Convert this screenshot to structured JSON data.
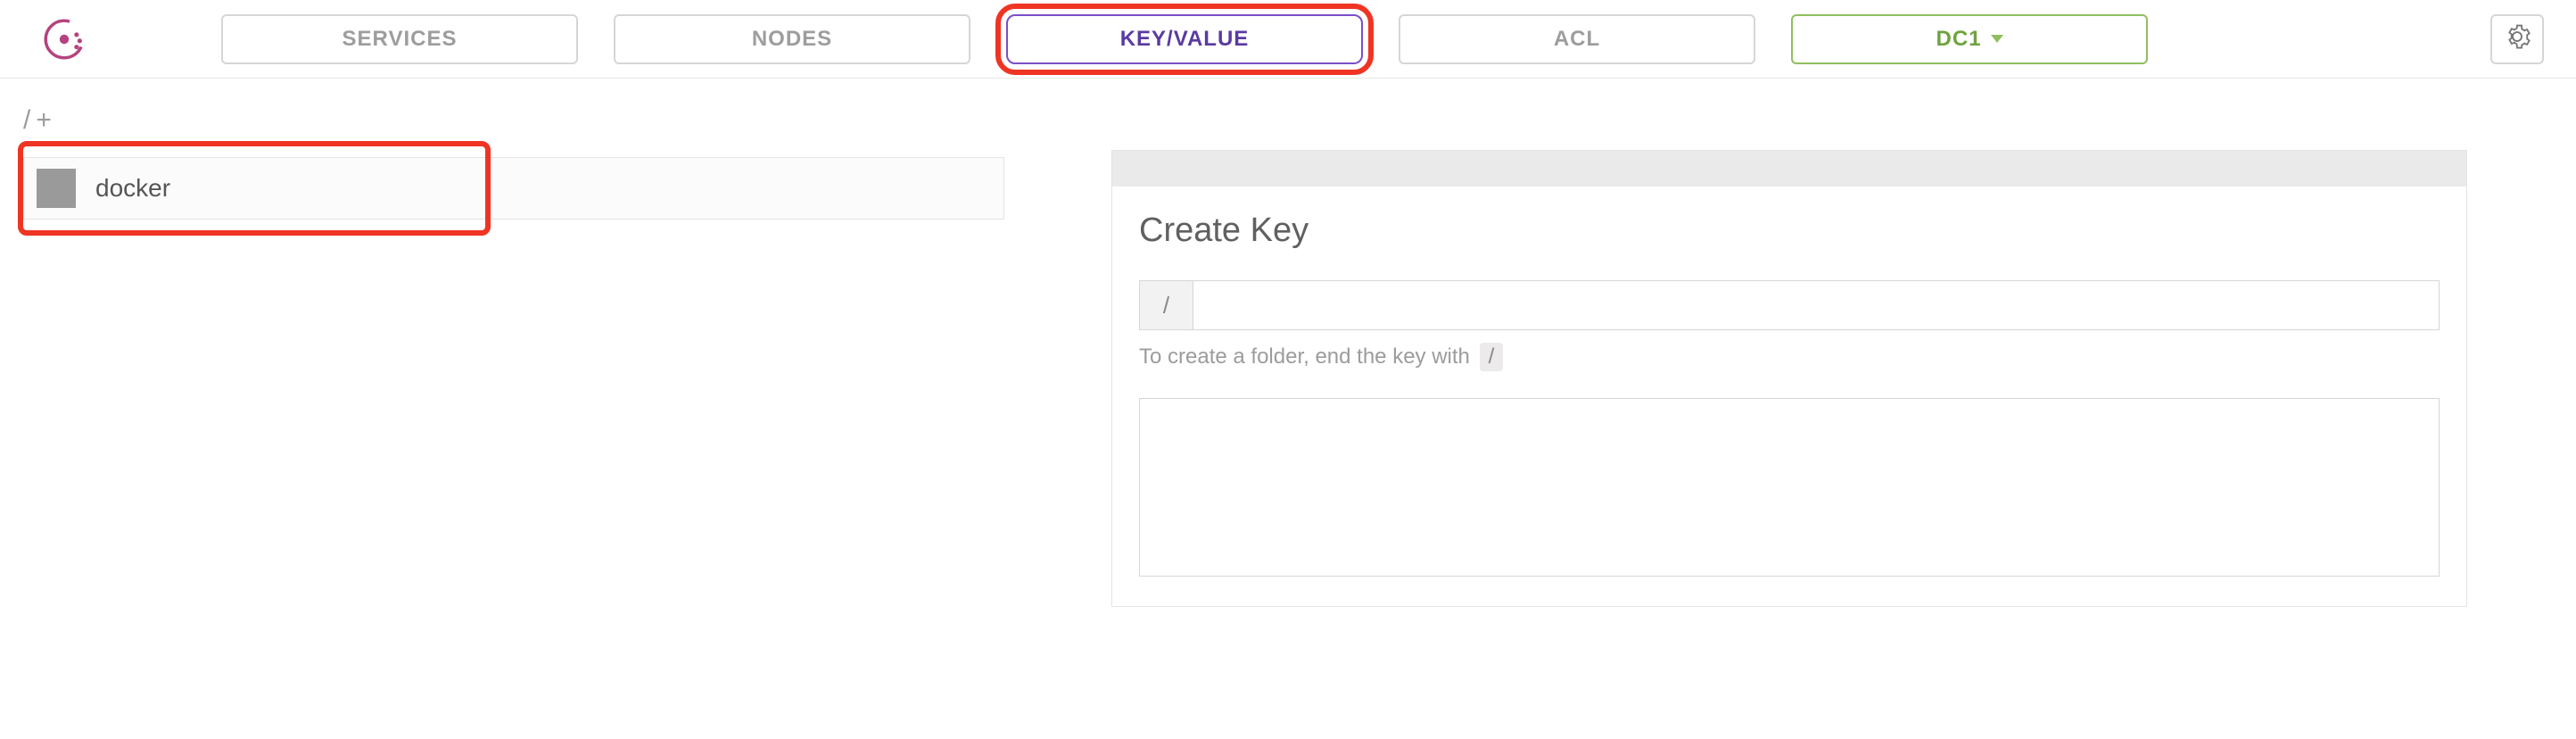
{
  "nav": {
    "services": "SERVICES",
    "nodes": "NODES",
    "keyvalue": "KEY/VALUE",
    "acl": "ACL",
    "datacenter": "DC1"
  },
  "breadcrumb": {
    "root": "/",
    "plus": "+"
  },
  "kv_list": {
    "item0": "docker"
  },
  "create_panel": {
    "title": "Create Key",
    "prefix": "/",
    "help_prefix": "To create a folder, end the key with",
    "help_slash": "/",
    "key_value": "",
    "body_value": ""
  }
}
